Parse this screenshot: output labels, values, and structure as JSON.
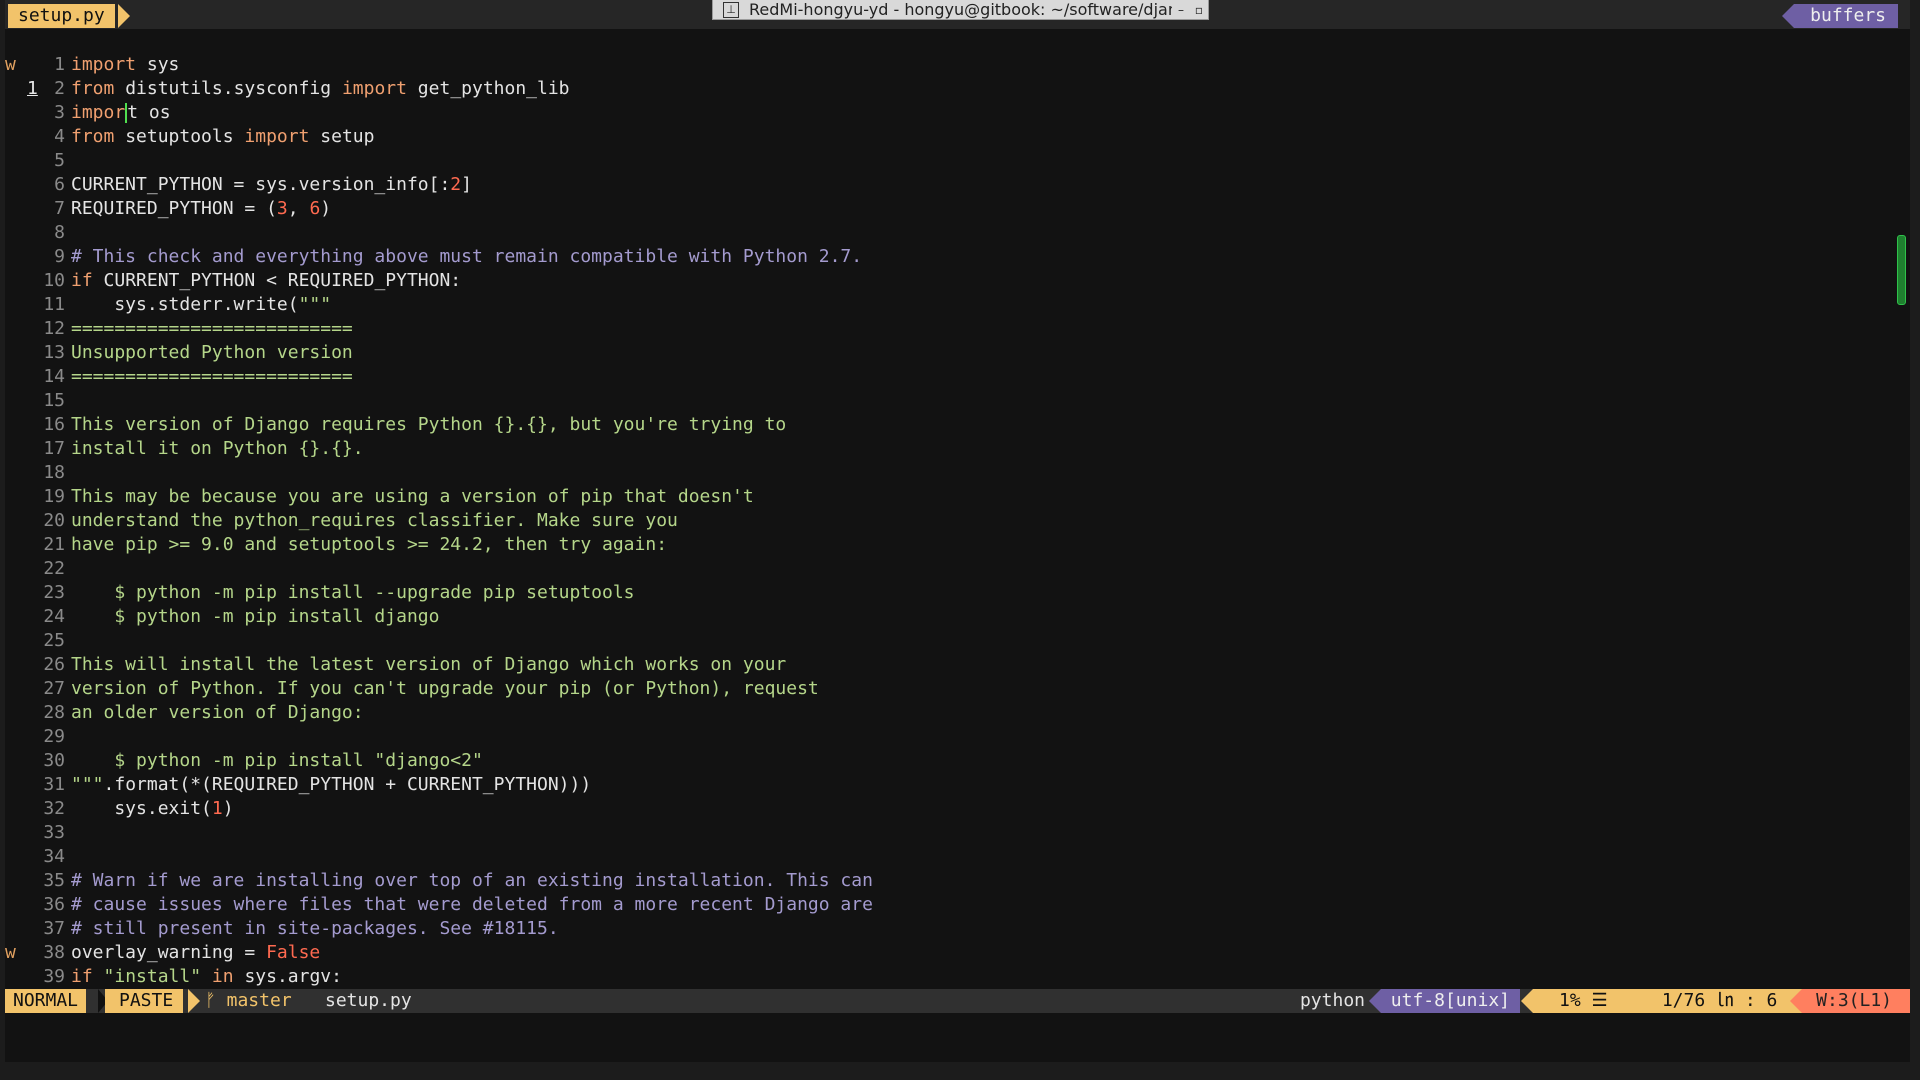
{
  "window": {
    "title": "RedMi-hongyu-yd - hongyu@gitbook: ~/software/djan",
    "pin_icon": "pin-icon",
    "min_label": "–",
    "restore_label": "▫"
  },
  "tabline": {
    "active_tab": "setup.py",
    "buffers_label": "buffers"
  },
  "editor": {
    "current_line": {
      "sign": "w",
      "number": "1",
      "pre": "impor",
      "post": "t os"
    },
    "lines": [
      {
        "n": "1",
        "segs": [
          {
            "c": "kw",
            "t": "import"
          },
          {
            "c": "",
            "t": " sys"
          }
        ]
      },
      {
        "n": "2",
        "segs": [
          {
            "c": "kw",
            "t": "from"
          },
          {
            "c": "",
            "t": " distutils.sysconfig "
          },
          {
            "c": "kw",
            "t": "import"
          },
          {
            "c": "",
            "t": " get_python_lib"
          }
        ]
      },
      {
        "n": "3",
        "segs": []
      },
      {
        "n": "4",
        "segs": [
          {
            "c": "kw",
            "t": "from"
          },
          {
            "c": "",
            "t": " setuptools "
          },
          {
            "c": "kw",
            "t": "import"
          },
          {
            "c": "",
            "t": " setup"
          }
        ]
      },
      {
        "n": "5",
        "segs": []
      },
      {
        "n": "6",
        "segs": [
          {
            "c": "",
            "t": "CURRENT_PYTHON = sys.version_info[:"
          },
          {
            "c": "num",
            "t": "2"
          },
          {
            "c": "",
            "t": "]"
          }
        ]
      },
      {
        "n": "7",
        "segs": [
          {
            "c": "",
            "t": "REQUIRED_PYTHON = ("
          },
          {
            "c": "num",
            "t": "3"
          },
          {
            "c": "",
            "t": ", "
          },
          {
            "c": "num",
            "t": "6"
          },
          {
            "c": "",
            "t": ")"
          }
        ]
      },
      {
        "n": "8",
        "segs": []
      },
      {
        "n": "9",
        "segs": [
          {
            "c": "com",
            "t": "# This check and everything above must remain compatible with Python 2.7."
          }
        ]
      },
      {
        "n": "10",
        "segs": [
          {
            "c": "kw",
            "t": "if"
          },
          {
            "c": "",
            "t": " CURRENT_PYTHON < REQUIRED_PYTHON:"
          }
        ]
      },
      {
        "n": "11",
        "segs": [
          {
            "c": "",
            "t": "    sys.stderr.write("
          },
          {
            "c": "str",
            "t": "\"\"\""
          }
        ]
      },
      {
        "n": "12",
        "segs": [
          {
            "c": "str",
            "t": "=========================="
          }
        ]
      },
      {
        "n": "13",
        "segs": [
          {
            "c": "str",
            "t": "Unsupported Python version"
          }
        ]
      },
      {
        "n": "14",
        "segs": [
          {
            "c": "str",
            "t": "=========================="
          }
        ]
      },
      {
        "n": "15",
        "segs": []
      },
      {
        "n": "16",
        "segs": [
          {
            "c": "str",
            "t": "This version of Django requires Python {}.{}, but you're trying to"
          }
        ]
      },
      {
        "n": "17",
        "segs": [
          {
            "c": "str",
            "t": "install it on Python {}.{}."
          }
        ]
      },
      {
        "n": "18",
        "segs": []
      },
      {
        "n": "19",
        "segs": [
          {
            "c": "str",
            "t": "This may be because you are using a version of pip that doesn't"
          }
        ]
      },
      {
        "n": "20",
        "segs": [
          {
            "c": "str",
            "t": "understand the python_requires classifier. Make sure you"
          }
        ]
      },
      {
        "n": "21",
        "segs": [
          {
            "c": "str",
            "t": "have pip >= 9.0 and setuptools >= 24.2, then try again:"
          }
        ]
      },
      {
        "n": "22",
        "segs": []
      },
      {
        "n": "23",
        "segs": [
          {
            "c": "str",
            "t": "    $ python -m pip install --upgrade pip setuptools"
          }
        ]
      },
      {
        "n": "24",
        "segs": [
          {
            "c": "str",
            "t": "    $ python -m pip install django"
          }
        ]
      },
      {
        "n": "25",
        "segs": []
      },
      {
        "n": "26",
        "segs": [
          {
            "c": "str",
            "t": "This will install the latest version of Django which works on your"
          }
        ]
      },
      {
        "n": "27",
        "segs": [
          {
            "c": "str",
            "t": "version of Python. If you can't upgrade your pip (or Python), request"
          }
        ]
      },
      {
        "n": "28",
        "segs": [
          {
            "c": "str",
            "t": "an older version of Django:"
          }
        ]
      },
      {
        "n": "29",
        "segs": []
      },
      {
        "n": "30",
        "segs": [
          {
            "c": "str",
            "t": "    $ python -m pip install \"django<2\""
          }
        ]
      },
      {
        "n": "31",
        "segs": [
          {
            "c": "str",
            "t": "\"\"\""
          },
          {
            "c": "",
            "t": ".format(*(REQUIRED_PYTHON + CURRENT_PYTHON)))"
          }
        ]
      },
      {
        "n": "32",
        "segs": [
          {
            "c": "",
            "t": "    sys.exit("
          },
          {
            "c": "num",
            "t": "1"
          },
          {
            "c": "",
            "t": ")"
          }
        ]
      },
      {
        "n": "33",
        "segs": []
      },
      {
        "n": "34",
        "segs": []
      },
      {
        "n": "35",
        "segs": [
          {
            "c": "com",
            "t": "# Warn if we are installing over top of an existing installation. This can"
          }
        ]
      },
      {
        "n": "36",
        "segs": [
          {
            "c": "com",
            "t": "# cause issues where files that were deleted from a more recent Django are"
          }
        ]
      },
      {
        "n": "37",
        "segs": [
          {
            "c": "com",
            "t": "# still present in site-packages. See #18115."
          }
        ]
      },
      {
        "n": "38",
        "sign": "w",
        "segs": [
          {
            "c": "",
            "t": "overlay_warning = "
          },
          {
            "c": "num",
            "t": "False"
          }
        ]
      },
      {
        "n": "39",
        "segs": [
          {
            "c": "kw",
            "t": "if"
          },
          {
            "c": "",
            "t": " "
          },
          {
            "c": "str",
            "t": "\"install\""
          },
          {
            "c": "",
            "t": " "
          },
          {
            "c": "kw",
            "t": "in"
          },
          {
            "c": "",
            "t": " sys.argv:"
          }
        ]
      }
    ]
  },
  "statusline": {
    "mode": "NORMAL",
    "paste": "PASTE",
    "branch": "ᚠ master",
    "filename": "setup.py",
    "filetype": "python",
    "encoding": "utf-8[unix]",
    "percent": "1% ☰",
    "position": "1/76 ㏑ :  6",
    "warning": "W:3(L1)"
  },
  "colors": {
    "accent": "#f2c36a",
    "purple": "#6e5fa4",
    "warning": "#ff7f5f",
    "keyword": "#f0a070",
    "string": "#b5d68a",
    "comment": "#a49bcf"
  }
}
